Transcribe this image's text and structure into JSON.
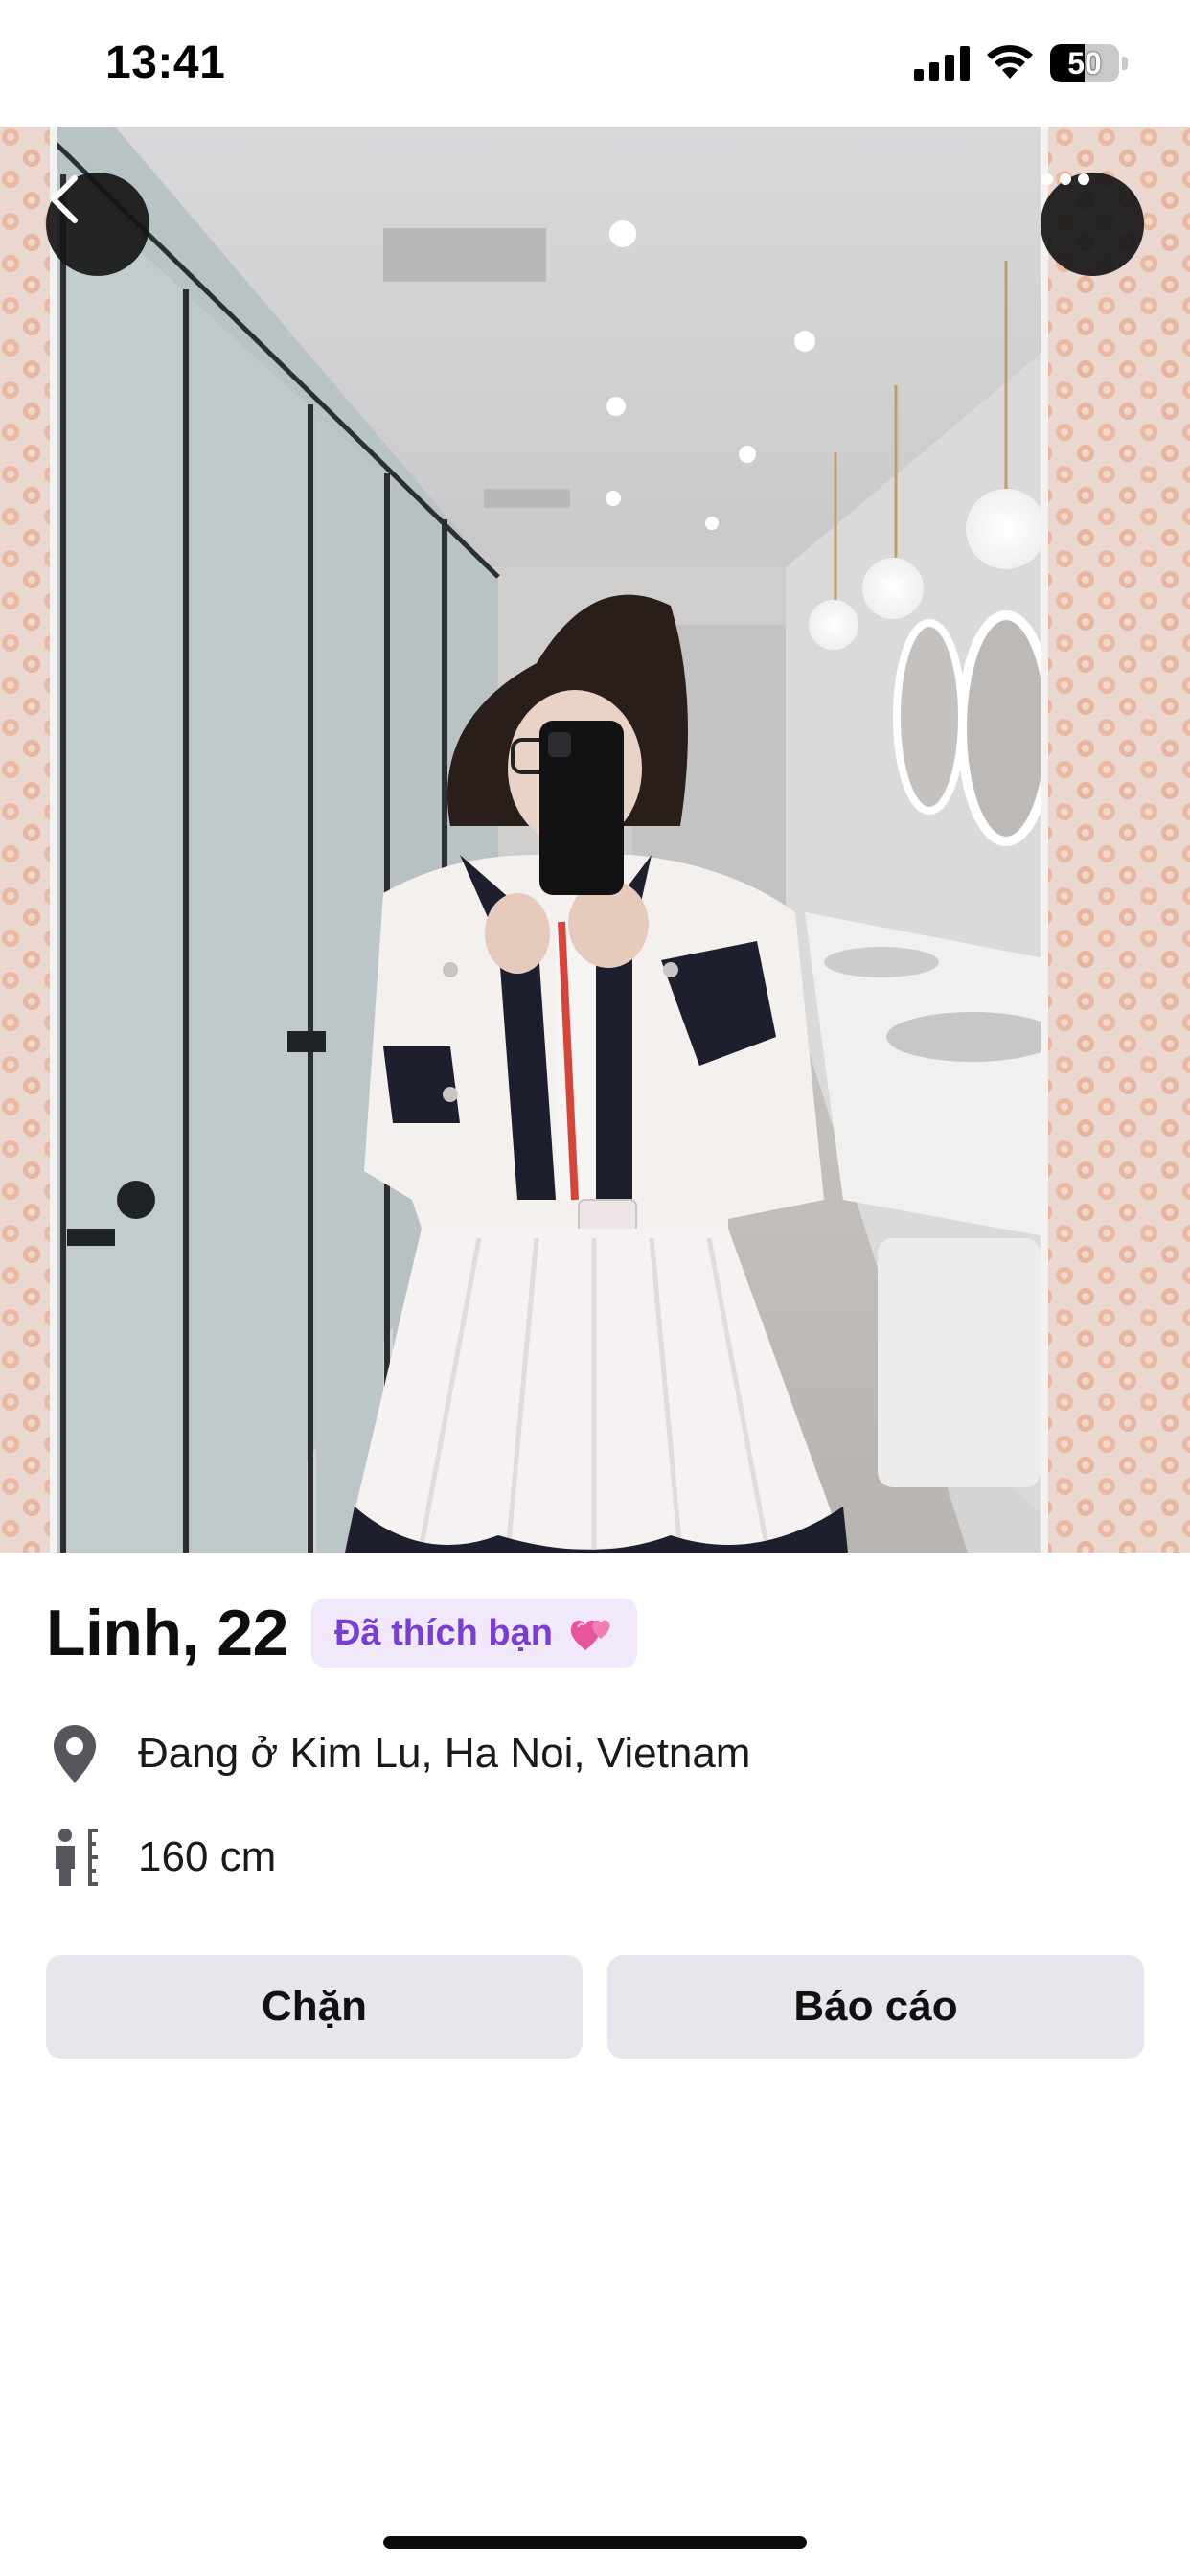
{
  "status_bar": {
    "time": "13:41",
    "battery_level": "50",
    "icons": [
      "signal-icon",
      "wifi-icon",
      "battery-icon"
    ]
  },
  "photo": {
    "top_buttons": {
      "back_icon": "chevron-left-icon",
      "more_icon": "more-horizontal-icon"
    }
  },
  "profile": {
    "name_age": "Linh, 22",
    "liked_badge": {
      "label": "Đã thích bạn",
      "icon": "two-hearts-icon",
      "color": "#7a3fd0",
      "background": "#f1e8fb"
    },
    "details": [
      {
        "icon": "location-pin-icon",
        "text": "Đang ở Kim Lu, Ha Noi, Vietnam"
      },
      {
        "icon": "height-icon",
        "text": "160 cm"
      }
    ]
  },
  "actions": {
    "block_label": "Chặn",
    "report_label": "Báo cáo"
  }
}
